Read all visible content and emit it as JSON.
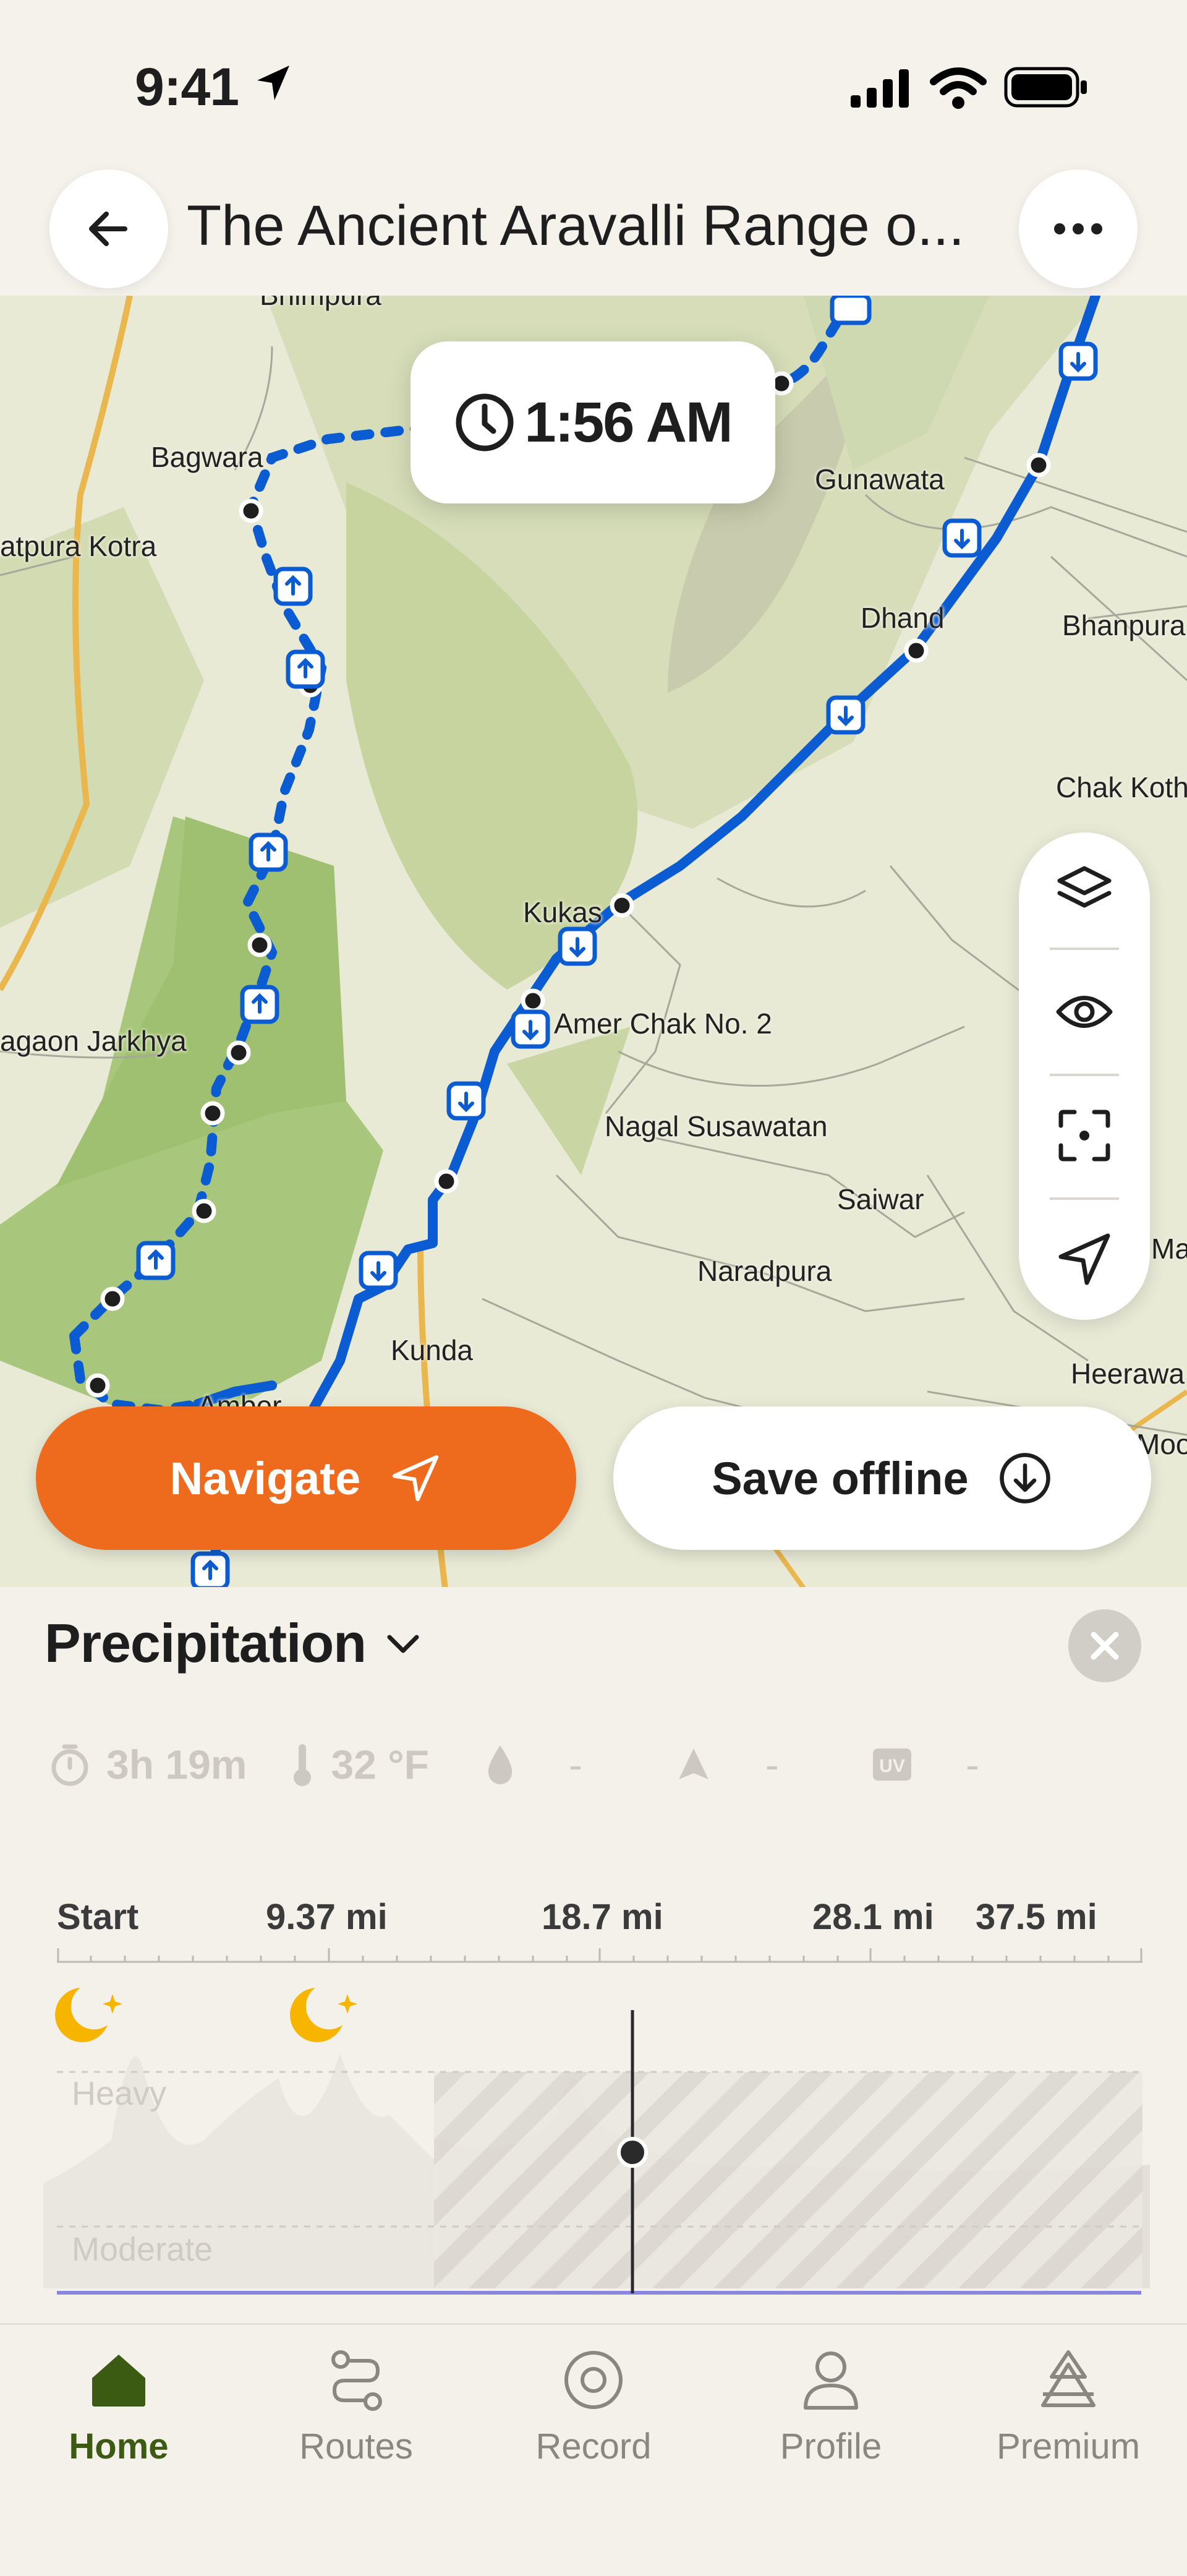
{
  "status_bar": {
    "time": "9:41"
  },
  "header": {
    "title": "The Ancient Aravalli Range o...",
    "back_icon": "arrow-left-icon",
    "more_icon": "more-horizontal-icon"
  },
  "map": {
    "time_pill": {
      "icon": "clock-icon",
      "text": "1:56 AM"
    },
    "places": [
      "Bhimpura",
      "Bagwara",
      "atpura Kotra",
      "Gunawata",
      "Dhand",
      "Bhanpura",
      "Chak Koth",
      "Kukas",
      "Amer Chak No. 2",
      "agaon Jarkhya",
      "Nagal Susawatan",
      "Saiwar",
      "Naradpura",
      "Mal",
      "Kunda",
      "Heerawa",
      "Amber",
      "Moo"
    ],
    "tools": [
      {
        "name": "layers",
        "icon": "layers-icon"
      },
      {
        "name": "visibility",
        "icon": "eye-icon"
      },
      {
        "name": "recenter",
        "icon": "focus-frame-icon"
      },
      {
        "name": "locate",
        "icon": "navigation-arrow-icon"
      }
    ],
    "colors": {
      "route": "#0b5bd3",
      "forest": "#a9c77c",
      "land": "#e8ead6"
    }
  },
  "actions": {
    "navigate_label": "Navigate",
    "save_offline_label": "Save offline",
    "navigate_color": "#ee6a1c"
  },
  "weather_panel": {
    "title": "Precipitation",
    "stats": [
      {
        "icon": "stopwatch-icon",
        "value": "3h 19m"
      },
      {
        "icon": "thermometer-icon",
        "value": "32 °F"
      },
      {
        "icon": "droplet-icon",
        "value": "-"
      },
      {
        "icon": "wind-arrow-icon",
        "value": "-"
      },
      {
        "icon": "uv-icon",
        "value": "-"
      }
    ],
    "distance_labels": [
      "Start",
      "9.37 mi",
      "18.7 mi",
      "28.1 mi",
      "37.5 mi"
    ],
    "levels": [
      "Heavy",
      "Moderate"
    ],
    "night_icons": [
      "moon-stars-icon",
      "moon-stars-icon"
    ]
  },
  "tabs": [
    {
      "label": "Home",
      "icon": "home-icon",
      "active": true
    },
    {
      "label": "Routes",
      "icon": "routes-icon",
      "active": false
    },
    {
      "label": "Record",
      "icon": "record-icon",
      "active": false
    },
    {
      "label": "Profile",
      "icon": "profile-icon",
      "active": false
    },
    {
      "label": "Premium",
      "icon": "premium-icon",
      "active": false
    }
  ]
}
